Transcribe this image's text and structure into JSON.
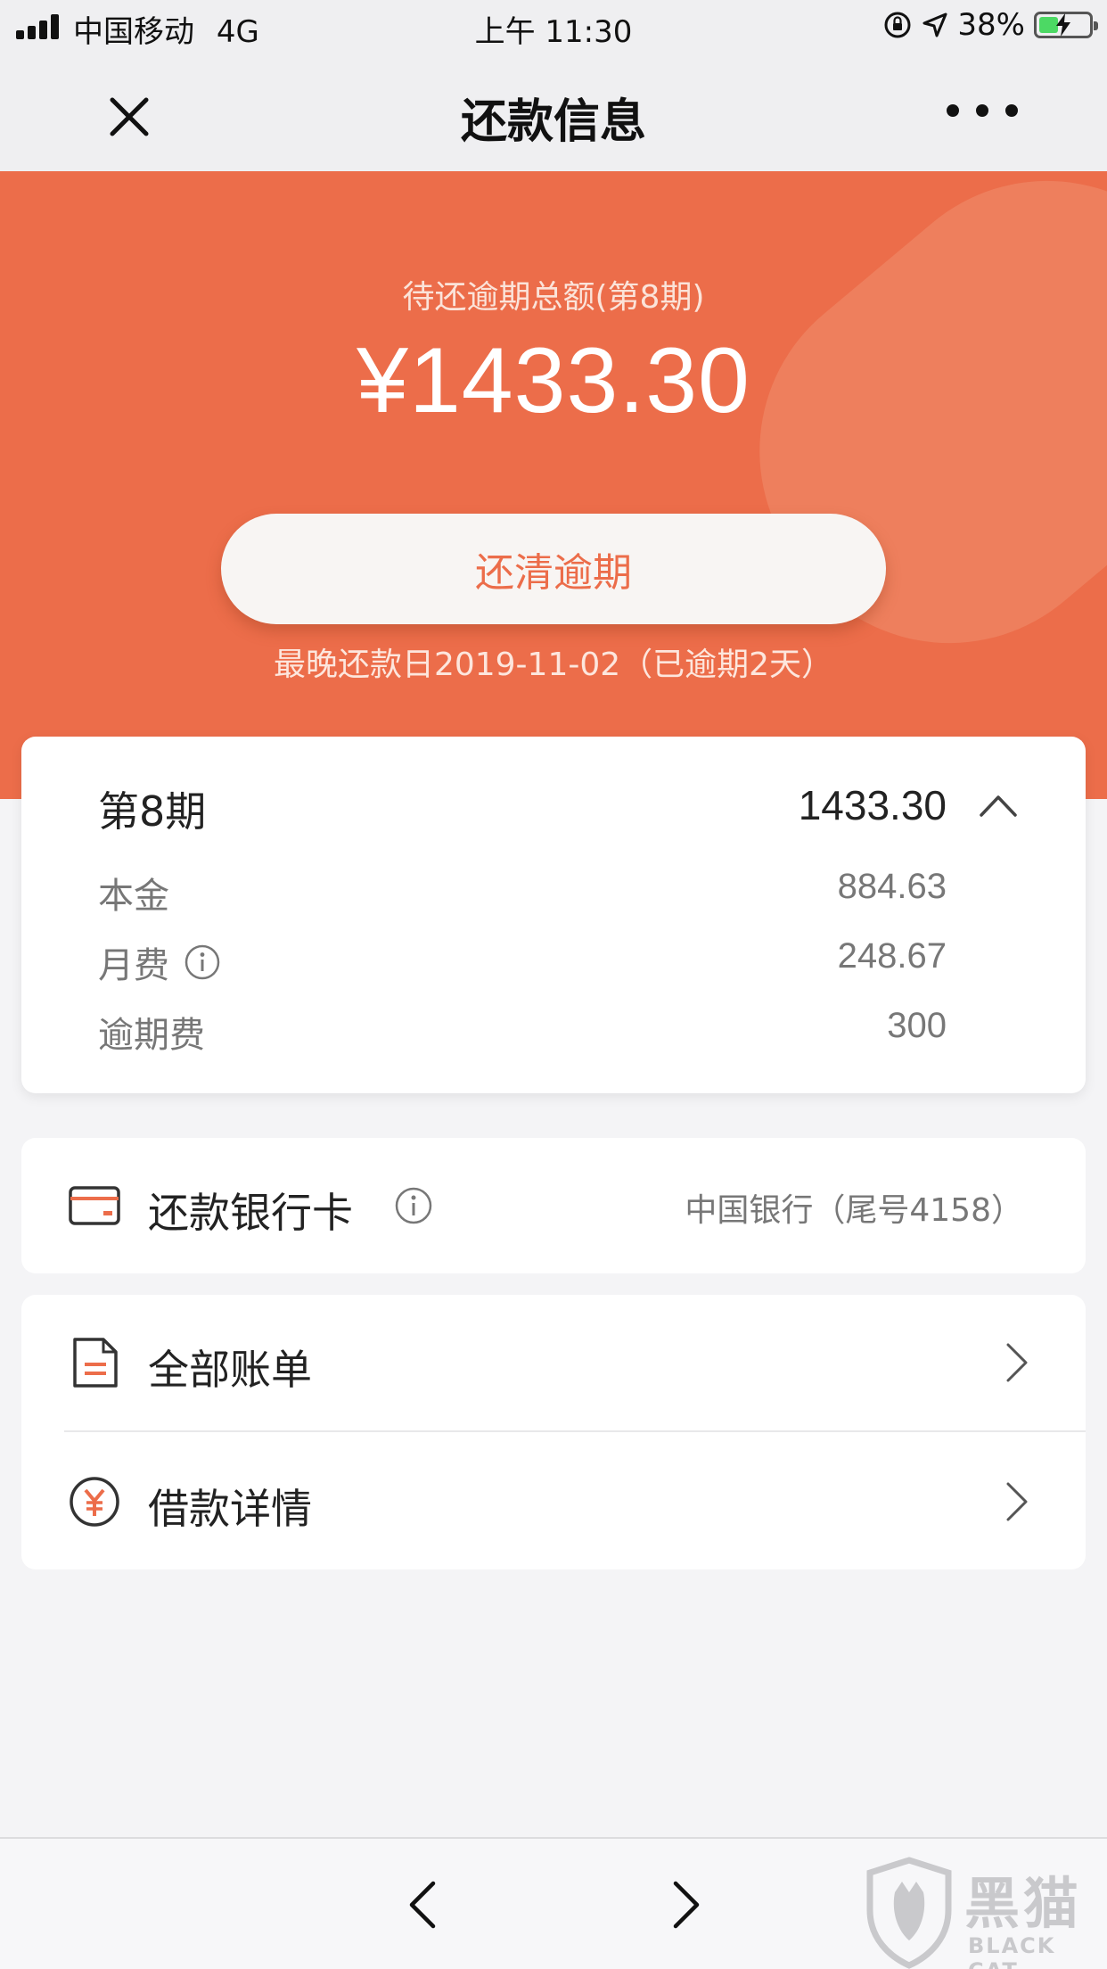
{
  "status_bar": {
    "carrier": "中国移动",
    "network": "4G",
    "time": "上午 11:30",
    "battery_percent": "38%",
    "battery_level": 0.38
  },
  "nav": {
    "title": "还款信息",
    "close_icon": "close-icon",
    "more_icon": "more-icon"
  },
  "hero": {
    "label": "待还逾期总额(第8期)",
    "amount": "¥1433.30",
    "button_label": "还清逾期",
    "due_text": "最晚还款日2019-11-02（已逾期2天）",
    "background_color": "#ec6d4a"
  },
  "period_card": {
    "title": "第8期",
    "total": "1433.30",
    "rows": [
      {
        "label": "本金",
        "value": "884.63"
      },
      {
        "label": "月费",
        "value": "248.67"
      },
      {
        "label": "逾期费",
        "value": "300"
      }
    ]
  },
  "bank_card": {
    "label": "还款银行卡",
    "value": "中国银行（尾号4158）"
  },
  "links": [
    {
      "label": "全部账单",
      "icon": "bill-icon"
    },
    {
      "label": "借款详情",
      "icon": "yuan-icon"
    }
  ],
  "watermark": {
    "main": "黑猫",
    "sub": "BLACK CAT"
  },
  "colors": {
    "accent": "#ec6d4a",
    "battery_green": "#4cd964"
  }
}
